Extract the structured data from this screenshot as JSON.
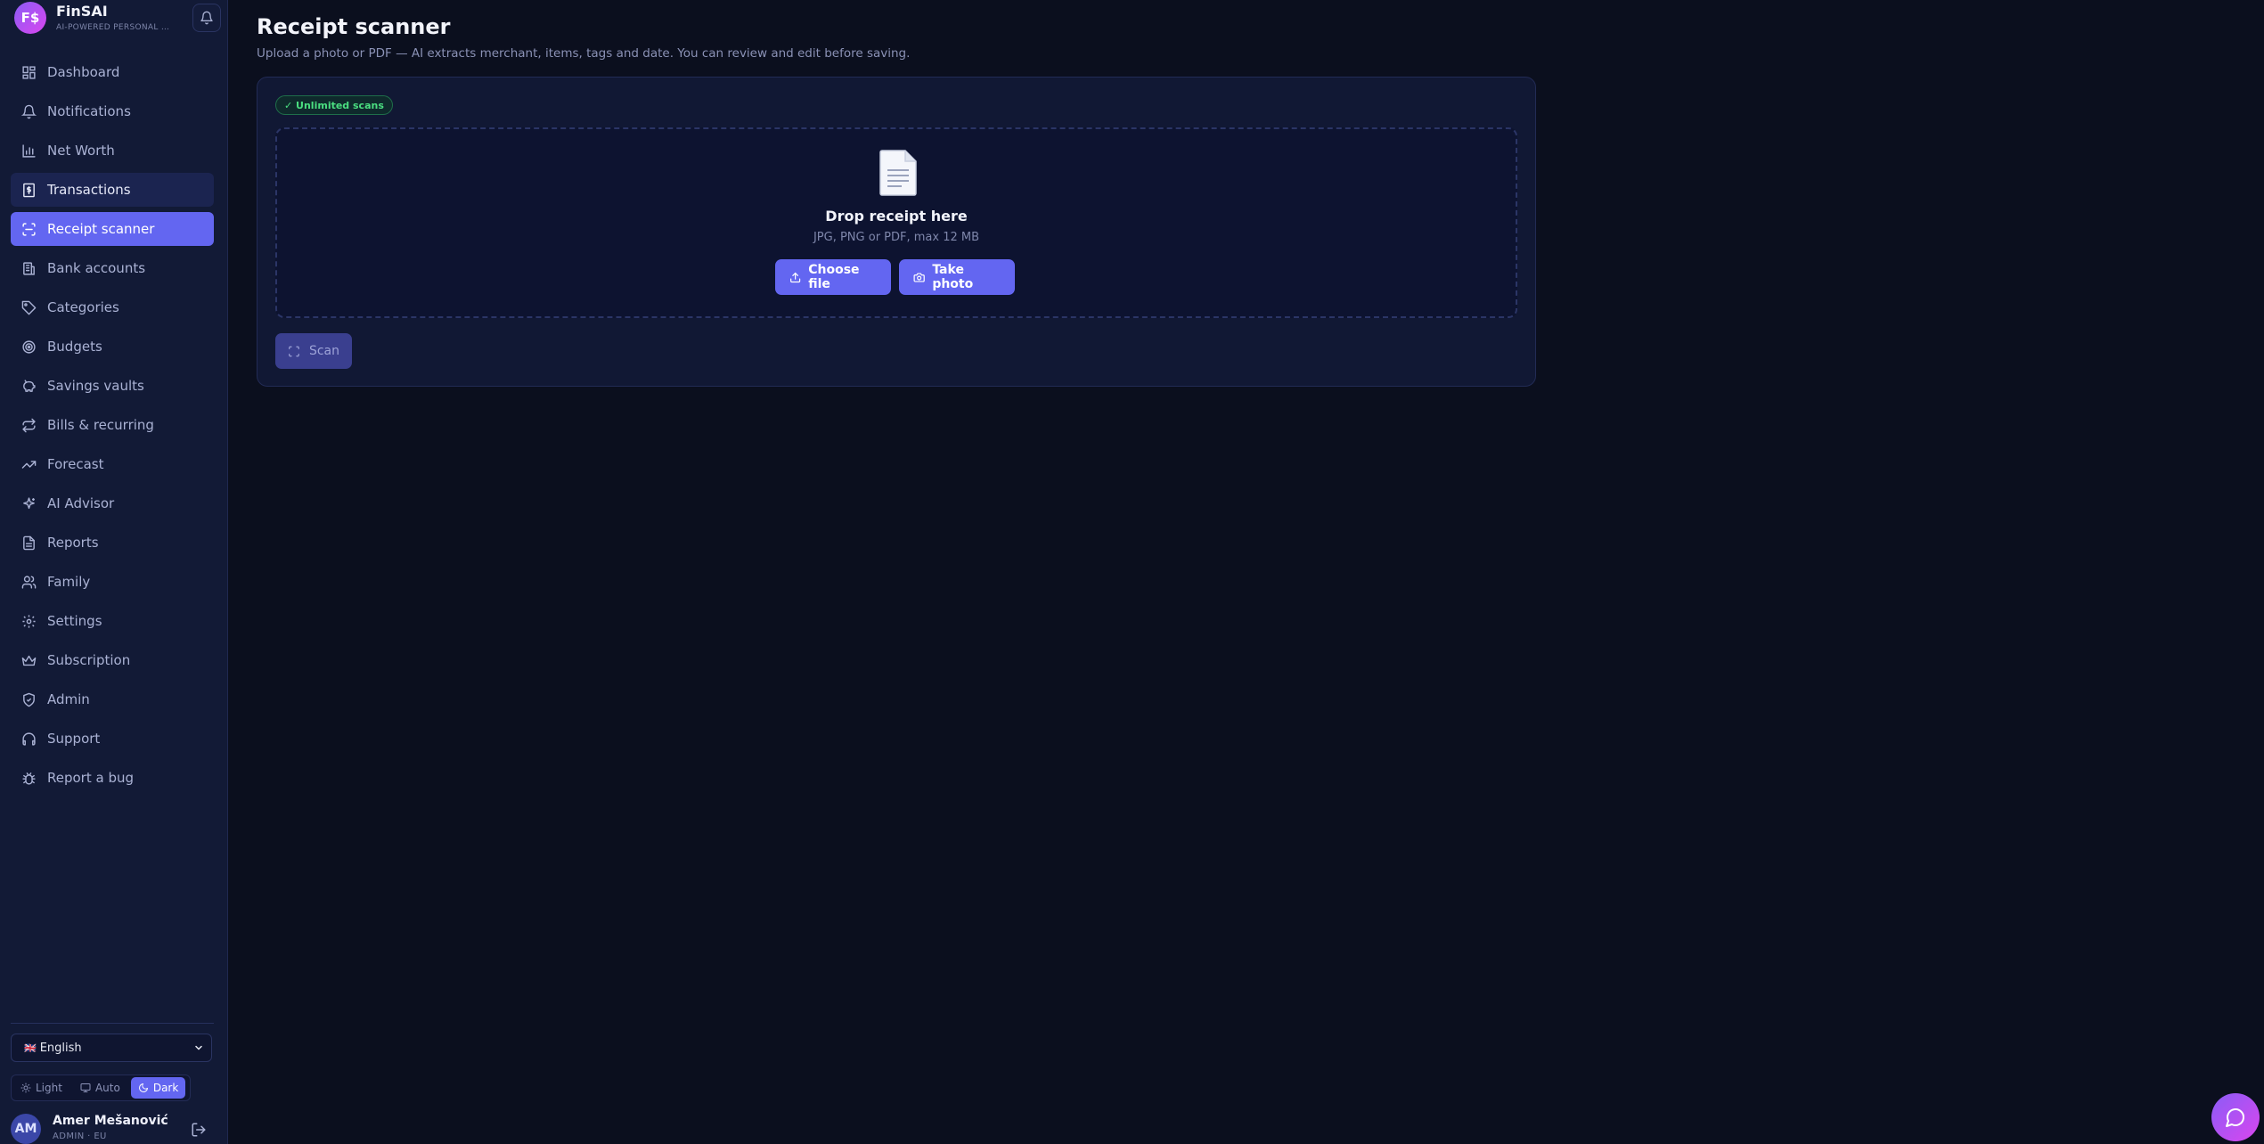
{
  "brand": {
    "logo_text": "F$",
    "name": "FinSAI",
    "tagline": "AI-POWERED PERSONAL FINANCE"
  },
  "sidebar": {
    "items": [
      {
        "label": "Dashboard",
        "icon": "dashboard-grid-icon"
      },
      {
        "label": "Notifications",
        "icon": "bell-icon"
      },
      {
        "label": "Net Worth",
        "icon": "bar-chart-icon"
      },
      {
        "label": "Transactions",
        "icon": "receipt-dollar-icon"
      },
      {
        "label": "Receipt scanner",
        "icon": "scan-icon"
      },
      {
        "label": "Bank accounts",
        "icon": "bank-icon"
      },
      {
        "label": "Categories",
        "icon": "tag-icon"
      },
      {
        "label": "Budgets",
        "icon": "target-icon"
      },
      {
        "label": "Savings vaults",
        "icon": "piggy-bank-icon"
      },
      {
        "label": "Bills & recurring",
        "icon": "repeat-icon"
      },
      {
        "label": "Forecast",
        "icon": "trending-up-icon"
      },
      {
        "label": "AI Advisor",
        "icon": "sparkles-icon"
      },
      {
        "label": "Reports",
        "icon": "file-text-icon"
      },
      {
        "label": "Family",
        "icon": "users-icon"
      },
      {
        "label": "Settings",
        "icon": "gear-icon"
      },
      {
        "label": "Subscription",
        "icon": "crown-icon"
      },
      {
        "label": "Admin",
        "icon": "shield-icon"
      },
      {
        "label": "Support",
        "icon": "headphones-icon"
      },
      {
        "label": "Report a bug",
        "icon": "bug-icon"
      }
    ],
    "active_item": "Receipt scanner",
    "language": {
      "flag": "🇬🇧",
      "value": "English"
    },
    "theme": {
      "light": "Light",
      "auto": "Auto",
      "dark": "Dark",
      "selected": "Dark"
    },
    "user": {
      "initials": "AM",
      "name": "Amer Mešanović",
      "role": "ADMIN · EU"
    }
  },
  "main": {
    "title": "Receipt scanner",
    "subtitle": "Upload a photo or PDF — AI extracts merchant, items, tags and date. You can review and edit before saving.",
    "badge": "✓ Unlimited scans",
    "dropzone": {
      "icon": "document-icon",
      "title": "Drop receipt here",
      "hint": "JPG, PNG or PDF, max 12 MB",
      "choose_label": "Choose file",
      "photo_label": "Take photo"
    },
    "scan_label": "Scan"
  },
  "colors": {
    "accent": "#6366f1",
    "background": "#0b0f1e",
    "sidebar": "#121a36",
    "success": "#4ade80"
  }
}
